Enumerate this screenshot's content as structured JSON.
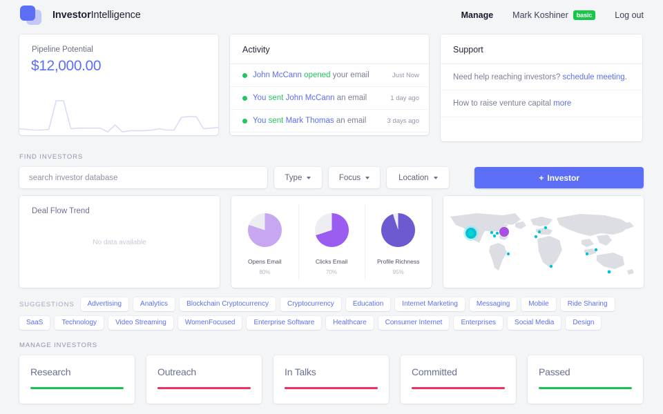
{
  "header": {
    "brand_bold": "Investor",
    "brand_light": "Intelligence",
    "manage_label": "Manage",
    "user_name": "Mark Koshiner",
    "user_plan_badge": "basic",
    "logout_label": "Log out"
  },
  "pipeline": {
    "label": "Pipeline Potential",
    "value": "$12,000.00",
    "accent_color": "#5b6ef5"
  },
  "activity": {
    "title": "Activity",
    "items": [
      {
        "subject": "John McCann",
        "verb": "opened",
        "rest": "your email",
        "time": "Just Now"
      },
      {
        "subject": "You",
        "verb": "sent",
        "object": "John McCann",
        "rest": "an email",
        "time": "1 day ago"
      },
      {
        "subject": "You",
        "verb": "sent",
        "object": "Mark Thomas",
        "rest": "an email",
        "time": "3 days ago"
      }
    ]
  },
  "support": {
    "title": "Support",
    "items": [
      {
        "text": "Need help reaching investors? ",
        "link": "schedule meeting",
        "suffix": "."
      },
      {
        "text": "How to raise venture capital ",
        "link": "more",
        "suffix": ""
      }
    ]
  },
  "find_investors": {
    "section_label": "Find Investors",
    "search_placeholder": "search investor database",
    "search_value": "",
    "filters": [
      {
        "label": "Type"
      },
      {
        "label": "Focus"
      },
      {
        "label": "Location"
      }
    ],
    "add_button_label": "Investor",
    "add_button_icon": "plus-icon",
    "add_button_color": "#5b6ef5"
  },
  "deal_flow": {
    "title": "Deal Flow Trend",
    "empty_text": "No data available"
  },
  "chart_data": [
    {
      "type": "line",
      "title": "Pipeline Potential",
      "name": "pipeline-sparkline",
      "x": [
        0,
        1,
        2,
        3,
        4,
        5,
        6,
        7,
        8,
        9,
        10,
        11,
        12,
        13,
        14,
        15,
        16,
        17,
        18,
        19,
        20,
        21,
        22,
        23,
        24,
        25,
        26,
        27
      ],
      "values": [
        8,
        7,
        6,
        6,
        7,
        52,
        52,
        8,
        9,
        9,
        9,
        9,
        3,
        14,
        3,
        5,
        5,
        5,
        6,
        8,
        6,
        6,
        26,
        27,
        27,
        8,
        9,
        10
      ],
      "xlabel": "",
      "ylabel": "",
      "grid": false,
      "legend": false,
      "line_color": "#d9dcf7"
    },
    {
      "type": "pie",
      "title": "Opens Email",
      "name": "opens-email-pie",
      "categories": [
        "Opens Email",
        "Remaining"
      ],
      "values": [
        80,
        20
      ],
      "label": "80%",
      "colors": [
        "#c7a8f0",
        "#eceef2"
      ]
    },
    {
      "type": "pie",
      "title": "Clicks Email",
      "name": "clicks-email-pie",
      "categories": [
        "Clicks Email",
        "Remaining"
      ],
      "values": [
        70,
        30
      ],
      "label": "70%",
      "colors": [
        "#9b5cf0",
        "#eceef2"
      ]
    },
    {
      "type": "pie",
      "title": "Profile Richness",
      "name": "profile-richness-pie",
      "categories": [
        "Profile Richness",
        "Remaining"
      ],
      "values": [
        95,
        5
      ],
      "label": "95%",
      "colors": [
        "#6d5ad1",
        "#eceef2"
      ]
    }
  ],
  "pies": [
    {
      "name": "Opens Email",
      "pct": "80%",
      "value": 80,
      "color": "#c7a8f0"
    },
    {
      "name": "Clicks Email",
      "pct": "70%",
      "value": 70,
      "color": "#9b5cf0"
    },
    {
      "name": "Profile Richness",
      "pct": "95%",
      "value": 95,
      "color": "#6d5ad1"
    }
  ],
  "map": {
    "marker_primary_color": "#00c4d6",
    "marker_secondary_color": "#a64fe0"
  },
  "suggestions": {
    "label": "Suggestions",
    "tags": [
      "Advertising",
      "Analytics",
      "Blockchain Cryptocurrency",
      "Cryptocurrency",
      "Education",
      "Internet Marketing",
      "Messaging",
      "Mobile",
      "Ride Sharing",
      "SaaS",
      "Technology",
      "Video Streaming",
      "WomenFocused",
      "Enterprise Software",
      "Healthcare",
      "Consumer Internet",
      "Enterprises",
      "Social Media",
      "Design"
    ]
  },
  "manage_investors": {
    "section_label": "Manage Investors",
    "columns": [
      {
        "title": "Research",
        "bar_color": "#15c453"
      },
      {
        "title": "Outreach",
        "bar_color": "#ef2e63"
      },
      {
        "title": "In Talks",
        "bar_color": "#ef2e63"
      },
      {
        "title": "Committed",
        "bar_color": "#ef2e63"
      },
      {
        "title": "Passed",
        "bar_color": "#15c453"
      }
    ]
  }
}
